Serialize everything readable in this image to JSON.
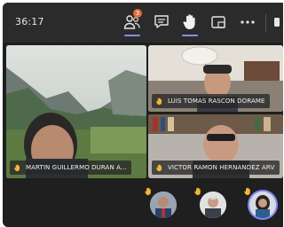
{
  "toolbar": {
    "timer": "36:17",
    "participants_badge": "3",
    "icons": [
      "participants-icon",
      "chat-icon",
      "raise-hand-icon",
      "share-tray-icon",
      "more-options-icon"
    ]
  },
  "tiles": [
    {
      "name": "MARTIN GUILLERMO DURAN A..."
    },
    {
      "name": "LUIS TOMAS RASCON DORAME"
    },
    {
      "name": "VICTOR RAMON HERNANDEZ ARVI..."
    }
  ],
  "colors": {
    "hand": "#f2b634",
    "accent": "#8b8cf2",
    "badge": "#e06a3b",
    "toolbar_bg": "#2b2b2b",
    "stage_bg": "#1f1f1f"
  }
}
